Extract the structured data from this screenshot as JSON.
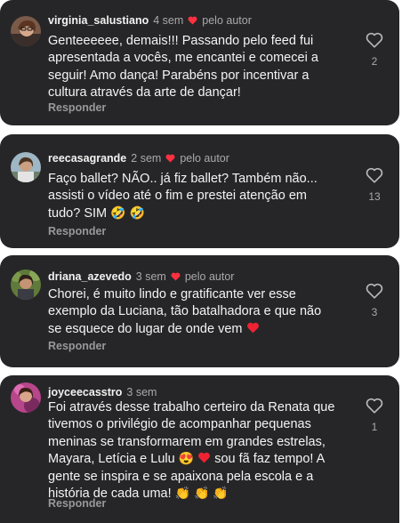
{
  "comments": [
    {
      "username": "virginia_salustiano",
      "time": "4 sem",
      "author_like_label": "pelo autor",
      "lines": [
        "Genteeeeee, demais!!! Passando pelo feed fui",
        "apresentada a vocês, me encantei e comecei a",
        "seguir! Amo dança! Parabéns por incentivar a",
        "cultura através da arte de dançar!"
      ],
      "reply_label": "Responder",
      "like_count": "2",
      "like_icon": "heart-outline-icon"
    },
    {
      "username": "reecasagrande",
      "time": "2 sem",
      "author_like_label": "pelo autor",
      "lines": [
        "Faço ballet? NÃO.. já fiz ballet? Também não...",
        "assisti o vídeo até o fim e prestei atenção em",
        "tudo? SIM"
      ],
      "line3_emoji": "🤣 🤣",
      "reply_label": "Responder",
      "like_count": "13",
      "like_icon": "heart-outline-icon"
    },
    {
      "username": "driana_azevedo",
      "time": "3 sem",
      "author_like_label": "pelo autor",
      "lines": [
        "Chorei, é muito lindo e gratificante ver esse",
        "exemplo da Luciana, tão batalhadora e que não",
        "se esquece do lugar de onde vem"
      ],
      "reply_label": "Responder",
      "like_count": "3",
      "like_icon": "heart-outline-icon"
    },
    {
      "username": "joyceecasstro",
      "time": "3 sem",
      "lines": [
        "Foi através desse trabalho certeiro da Renata que",
        "tivemos o privilégio de acompanhar pequenas",
        "meninas se transformarem em grandes estrelas,",
        "Mayara, Letícia e Lulu",
        "sou fã faz tempo! A",
        "gente se inspira e se apaixona pela escola e a",
        "história de cada uma!"
      ],
      "emoji_heart_eyes": "😍",
      "emoji_claps": "👏 👏 👏",
      "reply_label": "Responder",
      "like_count": "1",
      "like_icon": "heart-outline-icon"
    }
  ],
  "colors": {
    "card_bg": "#262628",
    "page_bg": "#ffffff",
    "text": "#f4f4f4",
    "muted": "#a9a9ad",
    "author_heart": "#ff3040"
  }
}
